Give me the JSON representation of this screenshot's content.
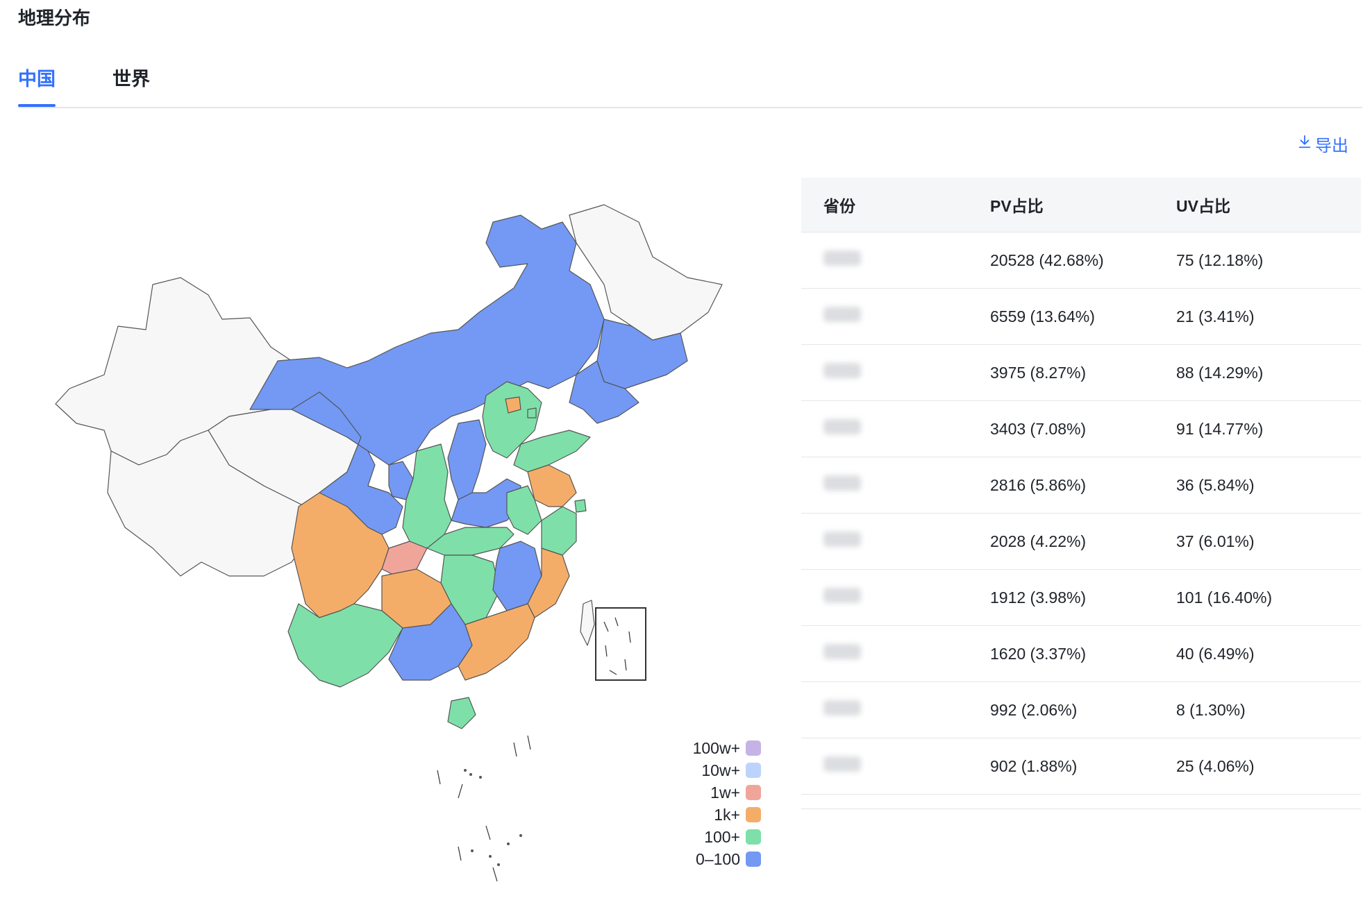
{
  "page": {
    "title": "地理分布"
  },
  "tabs": [
    {
      "label": "中国",
      "active": true
    },
    {
      "label": "世界",
      "active": false
    }
  ],
  "export": {
    "label": "导出",
    "icon": "download-icon"
  },
  "table": {
    "headers": [
      "省份",
      "PV占比",
      "UV占比"
    ],
    "rows": [
      {
        "province": "",
        "pv": "20528 (42.68%)",
        "uv": "75 (12.18%)"
      },
      {
        "province": "",
        "pv": "6559 (13.64%)",
        "uv": "21 (3.41%)"
      },
      {
        "province": "",
        "pv": "3975 (8.27%)",
        "uv": "88 (14.29%)"
      },
      {
        "province": "",
        "pv": "3403 (7.08%)",
        "uv": "91 (14.77%)"
      },
      {
        "province": "",
        "pv": "2816 (5.86%)",
        "uv": "36 (5.84%)"
      },
      {
        "province": "",
        "pv": "2028 (4.22%)",
        "uv": "37 (6.01%)"
      },
      {
        "province": "",
        "pv": "1912 (3.98%)",
        "uv": "101 (16.40%)"
      },
      {
        "province": "",
        "pv": "1620 (3.37%)",
        "uv": "40 (6.49%)"
      },
      {
        "province": "",
        "pv": "992 (2.06%)",
        "uv": "8 (1.30%)"
      },
      {
        "province": "",
        "pv": "902 (1.88%)",
        "uv": "25 (4.06%)"
      }
    ]
  },
  "legend": [
    {
      "label": "100w+",
      "color": "#c5b3e6"
    },
    {
      "label": "10w+",
      "color": "#bcd3fb"
    },
    {
      "label": "1w+",
      "color": "#f0a59b"
    },
    {
      "label": "1k+",
      "color": "#f4ad69"
    },
    {
      "label": "100+",
      "color": "#7ee0a8"
    },
    {
      "label": "0–100",
      "color": "#7399f5"
    }
  ],
  "colors": {
    "accent": "#3370ff",
    "no_data": "#f7f7f7",
    "border": "#e5e6eb"
  }
}
